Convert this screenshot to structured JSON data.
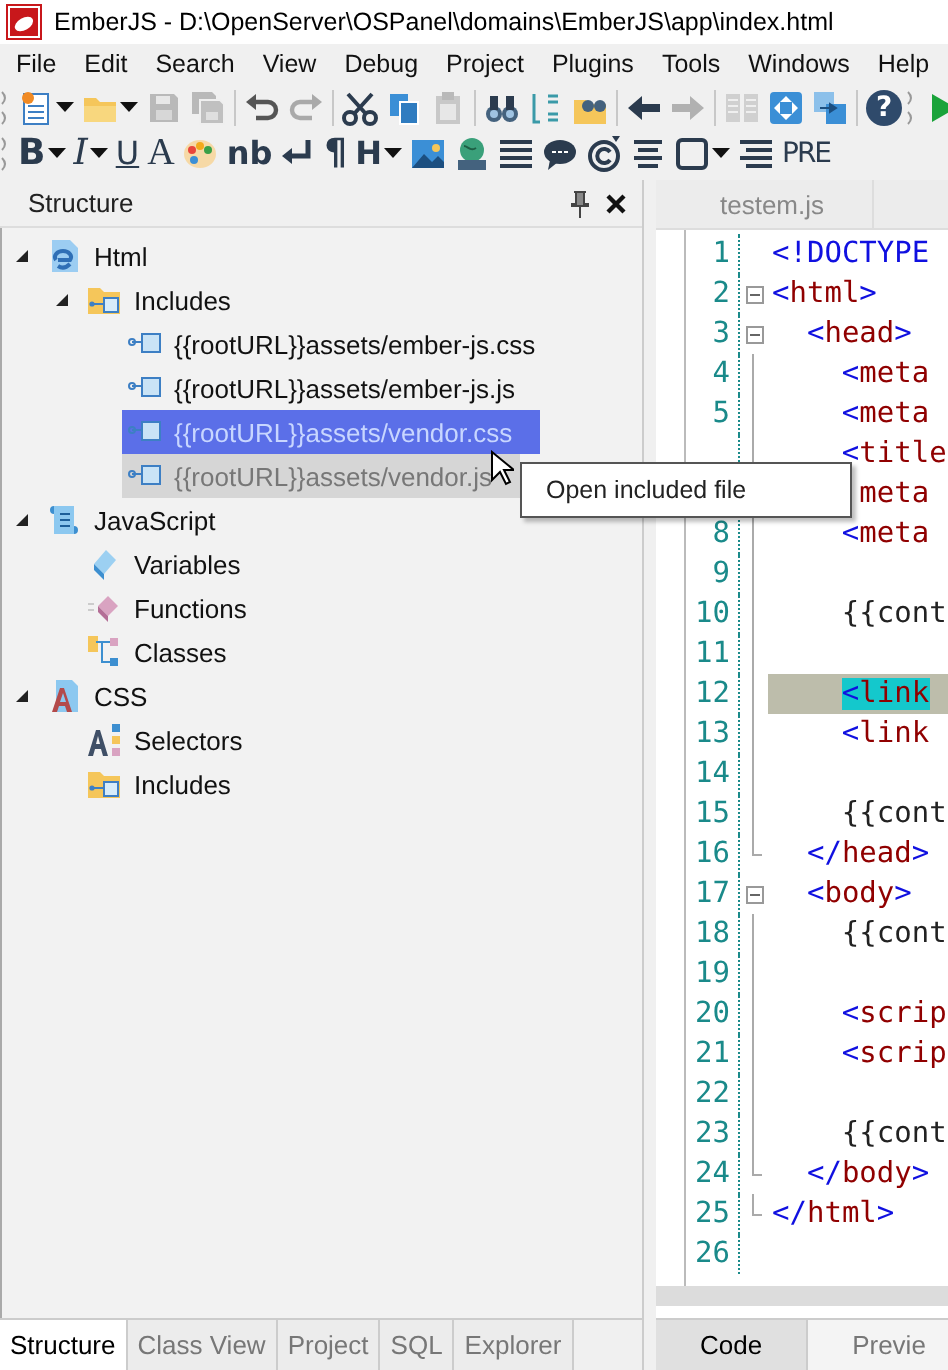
{
  "window": {
    "title": "EmberJS - D:\\OpenServer\\OSPanel\\domains\\EmberJS\\app\\index.html"
  },
  "menu": [
    "File",
    "Edit",
    "Search",
    "View",
    "Debug",
    "Project",
    "Plugins",
    "Tools",
    "Windows",
    "Help"
  ],
  "main_toolbar": [
    {
      "dropdown": true,
      "disabled": false
    },
    {
      "dropdown": true,
      "disabled": false
    },
    {
      "dropdown": false,
      "disabled": true
    },
    {
      "dropdown": false,
      "disabled": true
    },
    {
      "dropdown": false,
      "disabled": false
    },
    {
      "dropdown": false,
      "disabled": true
    },
    {
      "dropdown": false,
      "disabled": false
    },
    {
      "dropdown": false,
      "disabled": false
    },
    {
      "dropdown": false,
      "disabled": true
    },
    {
      "dropdown": false,
      "disabled": false
    },
    {
      "dropdown": false,
      "disabled": false
    },
    {
      "dropdown": false,
      "disabled": false
    },
    {
      "dropdown": false,
      "disabled": false
    },
    {
      "dropdown": false,
      "disabled": true
    },
    {
      "dropdown": false,
      "disabled": true
    },
    {
      "dropdown": false,
      "disabled": false
    },
    {
      "dropdown": false,
      "disabled": false
    },
    {
      "label": "?",
      "dropdown": false,
      "disabled": false
    },
    {
      "dropdown": false,
      "disabled": false
    }
  ],
  "format_toolbar": [
    {
      "label": "B",
      "dropdown": true
    },
    {
      "label": "I",
      "dropdown": true
    },
    {
      "label": "U",
      "dropdown": false
    },
    {
      "label": "A",
      "dropdown": false
    },
    {
      "dropdown": false
    },
    {
      "label": "nb",
      "dropdown": false
    },
    {
      "dropdown": false
    },
    {
      "label": "¶",
      "dropdown": false
    },
    {
      "label": "H",
      "dropdown": true
    },
    {
      "dropdown": false
    },
    {
      "dropdown": false
    },
    {
      "dropdown": false
    },
    {
      "dropdown": false
    },
    {
      "dropdown": false
    },
    {
      "dropdown": false
    },
    {
      "dropdown": true
    },
    {
      "dropdown": false
    },
    {
      "label": "PRE",
      "dropdown": false
    }
  ],
  "structure_panel": {
    "title": "Structure",
    "tree": [
      {
        "kind": "html",
        "label": "Html",
        "expanded": true,
        "selected": false,
        "hovered": false,
        "children": [
          {
            "kind": "includes",
            "label": "Includes",
            "expanded": true,
            "selected": false,
            "hovered": false,
            "children": [
              {
                "kind": "file",
                "label": "{{rootURL}}assets/ember-js.css",
                "selected": false,
                "hovered": false
              },
              {
                "kind": "file",
                "label": "{{rootURL}}assets/ember-js.js",
                "selected": false,
                "hovered": false
              },
              {
                "kind": "file",
                "label": "{{rootURL}}assets/vendor.css",
                "selected": true,
                "hovered": false
              },
              {
                "kind": "file",
                "label": "{{rootURL}}assets/vendor.js",
                "selected": false,
                "hovered": true
              }
            ]
          }
        ]
      },
      {
        "kind": "javascript",
        "label": "JavaScript",
        "expanded": true,
        "selected": false,
        "hovered": false,
        "children": [
          {
            "kind": "variables",
            "label": "Variables",
            "selected": false,
            "hovered": false
          },
          {
            "kind": "functions",
            "label": "Functions",
            "selected": false,
            "hovered": false
          },
          {
            "kind": "classes",
            "label": "Classes",
            "selected": false,
            "hovered": false
          }
        ]
      },
      {
        "kind": "css",
        "label": "CSS",
        "expanded": true,
        "selected": false,
        "hovered": false,
        "children": [
          {
            "kind": "selectors",
            "label": "Selectors",
            "selected": false,
            "hovered": false
          },
          {
            "kind": "includes",
            "label": "Includes",
            "selected": false,
            "hovered": false
          }
        ]
      }
    ],
    "tabs": [
      {
        "label": "Structure",
        "selected": true
      },
      {
        "label": "Class View",
        "selected": false
      },
      {
        "label": "Project",
        "selected": false
      },
      {
        "label": "SQL",
        "selected": false
      },
      {
        "label": "Explorer",
        "selected": false
      }
    ]
  },
  "editor": {
    "tabs": [
      {
        "label": "testem.js",
        "selected": false
      }
    ],
    "lines": [
      {
        "number": "1",
        "code": "<!DOCTYPE",
        "collapsible": false,
        "block_end": false,
        "highlighted": false
      },
      {
        "number": "2",
        "code": "<html>",
        "collapsible": true,
        "block_end": false,
        "highlighted": false
      },
      {
        "number": "3",
        "code": "  <head>",
        "collapsible": true,
        "block_end": false,
        "highlighted": false
      },
      {
        "number": "4",
        "code": "    <meta",
        "collapsible": false,
        "block_end": false,
        "highlighted": false
      },
      {
        "number": "5",
        "code": "    <meta",
        "collapsible": false,
        "block_end": false,
        "highlighted": false
      },
      {
        "code": "    <title",
        "collapsible": false,
        "block_end": false,
        "highlighted": false
      },
      {
        "code": "     meta",
        "highlighted": false
      },
      {
        "number": "8",
        "code": "    <meta",
        "collapsible": false,
        "block_end": false,
        "highlighted": false
      },
      {
        "number": "9",
        "collapsible": false,
        "block_end": false,
        "highlighted": false
      },
      {
        "number": "10",
        "code": "    {{cont",
        "collapsible": false,
        "block_end": false,
        "highlighted": false
      },
      {
        "number": "11",
        "collapsible": false,
        "block_end": false,
        "highlighted": false
      },
      {
        "number": "12",
        "code": "    <link",
        "collapsible": false,
        "block_end": false,
        "highlighted": true
      },
      {
        "number": "13",
        "code": "    <link",
        "collapsible": false,
        "block_end": false,
        "highlighted": false
      },
      {
        "number": "14",
        "collapsible": false,
        "block_end": false,
        "highlighted": false
      },
      {
        "number": "15",
        "code": "    {{cont",
        "collapsible": false,
        "block_end": false,
        "highlighted": false
      },
      {
        "number": "16",
        "code": "  </head>",
        "collapsible": false,
        "block_end": true,
        "highlighted": false
      },
      {
        "number": "17",
        "code": "  <body>",
        "collapsible": true,
        "block_end": false,
        "highlighted": false
      },
      {
        "number": "18",
        "code": "    {{cont",
        "collapsible": false,
        "block_end": false,
        "highlighted": false
      },
      {
        "number": "19",
        "collapsible": false,
        "block_end": false,
        "highlighted": false
      },
      {
        "number": "20",
        "code": "    <scrip",
        "collapsible": false,
        "block_end": false,
        "highlighted": false
      },
      {
        "number": "21",
        "code": "    <scrip",
        "collapsible": false,
        "block_end": false,
        "highlighted": false
      },
      {
        "number": "22",
        "collapsible": false,
        "block_end": false,
        "highlighted": false
      },
      {
        "number": "23",
        "code": "    {{cont",
        "collapsible": false,
        "block_end": false,
        "highlighted": false
      },
      {
        "number": "24",
        "code": "  </body>",
        "collapsible": false,
        "block_end": true,
        "highlighted": false
      },
      {
        "number": "25",
        "code": "</html>",
        "collapsible": false,
        "block_end": true,
        "highlighted": false
      },
      {
        "number": "26",
        "collapsible": false,
        "block_end": false,
        "highlighted": false
      }
    ],
    "view_tabs": [
      {
        "label": "Code",
        "selected": true
      },
      {
        "label": "Previe",
        "selected": false
      }
    ]
  },
  "tooltip": {
    "text": "Open included file"
  }
}
